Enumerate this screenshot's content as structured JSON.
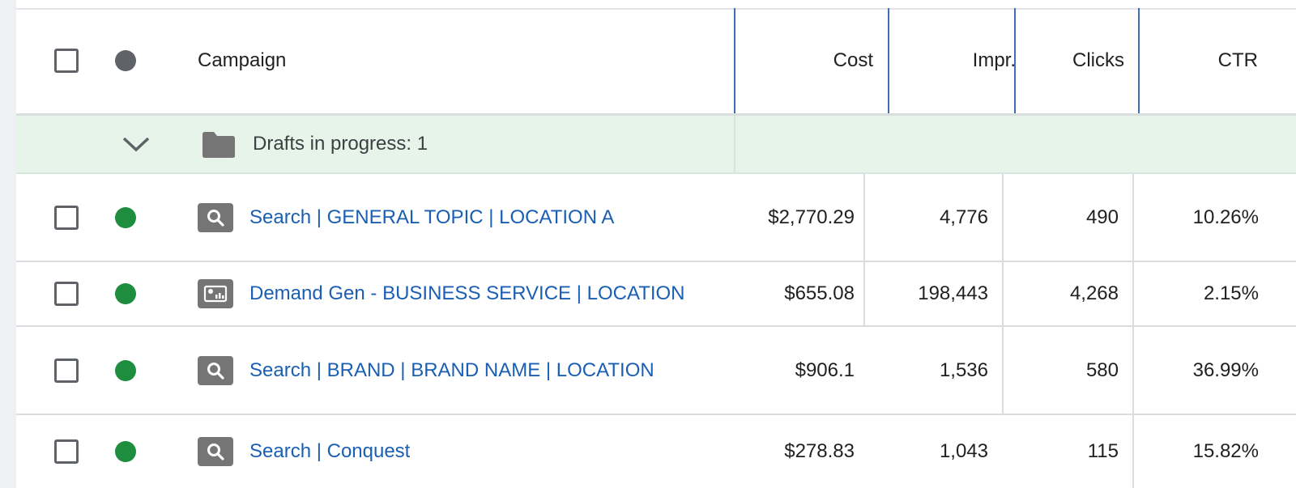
{
  "header": {
    "campaign_label": "Campaign",
    "cost_label": "Cost",
    "impr_label": "Impr.",
    "clicks_label": "Clicks",
    "ctr_label": "CTR"
  },
  "drafts": {
    "label": "Drafts in progress: 1",
    "folder_icon": "folder-icon",
    "expand_icon": "chevron-down-icon"
  },
  "campaigns": [
    {
      "name": "Search | GENERAL TOPIC | LOCATION A",
      "type_icon": "search-icon",
      "cost": "$2,770.29",
      "impr": "4,776",
      "clicks": "490",
      "ctr": "10.26%",
      "status": "enabled"
    },
    {
      "name": "Demand Gen - BUSINESS SERVICE | LOCATION",
      "type_icon": "demand-gen-icon",
      "cost": "$655.08",
      "impr": "198,443",
      "clicks": "4,268",
      "ctr": "2.15%",
      "status": "enabled"
    },
    {
      "name": "Search | BRAND | BRAND NAME | LOCATION",
      "type_icon": "search-icon",
      "cost": "$906.1",
      "impr": "1,536",
      "clicks": "580",
      "ctr": "36.99%",
      "status": "enabled"
    },
    {
      "name": "Search | Conquest",
      "type_icon": "search-icon",
      "cost": "$278.83",
      "impr": "1,043",
      "clicks": "115",
      "ctr": "15.82%",
      "status": "enabled"
    }
  ],
  "colors": {
    "link": "#1a5fb4",
    "status_enabled": "#1e8e3e",
    "status_header": "#5f6368",
    "draft_bg": "#e6f4ea",
    "column_divider": "#3c6fb5"
  }
}
